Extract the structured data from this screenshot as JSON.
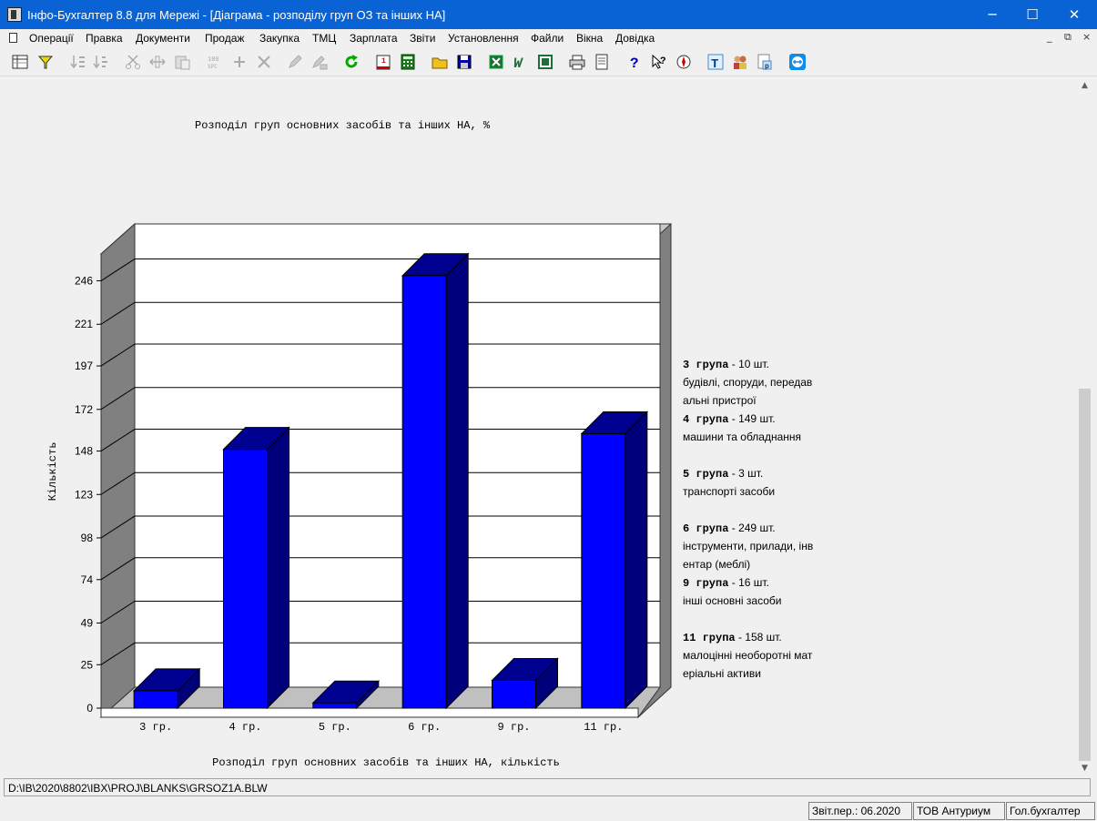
{
  "window": {
    "title": "Інфо-Бухгалтер 8.8 для Мережі - [Діаграма - розподілу груп ОЗ та інших НА]",
    "minimize": "─",
    "maximize": "☐",
    "close": "✕"
  },
  "menu": {
    "items": [
      "Операції",
      "Правка",
      "Документи",
      "Продаж",
      "Закупка",
      "ТМЦ",
      "Зарплата",
      "Звіти",
      "Установлення",
      "Файли",
      "Вікна",
      "Довідка"
    ],
    "mdi_minimize": "_",
    "mdi_restore": "⧉",
    "mdi_close": "×"
  },
  "toolbar": {
    "icons": [
      "grid-icon",
      "filter-icon",
      "sort-asc-icon",
      "sort-desc-icon",
      "cut-icon",
      "move-icon",
      "paste-icon",
      "rotate-icon",
      "add-icon",
      "delete-icon",
      "edit-icon",
      "spray-icon",
      "refresh-icon",
      "calendar-icon",
      "calculator-icon",
      "open-folder-icon",
      "save-icon",
      "excel-icon",
      "word-icon",
      "export-icon",
      "print-icon",
      "preview-icon",
      "help-icon",
      "context-help-icon",
      "compass-icon",
      "text-tool-icon",
      "users-icon",
      "report-icon",
      "teamviewer-icon"
    ]
  },
  "chart": {
    "title": "Розподіл груп основних засобів та інших НА, %",
    "ylabel": "Кількість",
    "xlabel": "Розподіл груп основних засобів та інших НА, кількість",
    "bar_color": "#0000ff",
    "bar_top_color": "#000090",
    "bar_side_color": "#00007a"
  },
  "chart_data": {
    "type": "bar",
    "categories": [
      "3  гр.",
      "4  гр.",
      "5  гр.",
      "6  гр.",
      "9  гр.",
      "11 гр."
    ],
    "values": [
      10,
      149,
      3,
      249,
      16,
      158
    ],
    "yticks": [
      0,
      25,
      49,
      74,
      98,
      123,
      148,
      172,
      197,
      221,
      246
    ],
    "ylim": [
      0,
      262
    ],
    "grid": true,
    "ylabel": "Кількість",
    "xlabel": "Розподіл груп основних засобів та інших НА, кількість",
    "title": "Розподіл груп основних засобів та інших НА, %"
  },
  "legend": [
    {
      "group": "3   група",
      "count": " - 10 шт.",
      "lines": [
        "будівлі, споруди, передав",
        "альні пристрої"
      ]
    },
    {
      "group": "4   група",
      "count": " - 149 шт.",
      "lines": [
        "машини та обладнання",
        ""
      ]
    },
    {
      "group": "5   група",
      "count": " - 3 шт.",
      "lines": [
        "транспорті засоби",
        ""
      ]
    },
    {
      "group": "6   група",
      "count": " - 249 шт.",
      "lines": [
        "інструменти, прилади, інв",
        "ентар (меблі)"
      ]
    },
    {
      "group": "9   група",
      "count": " - 16 шт.",
      "lines": [
        "інші основні засоби",
        ""
      ]
    },
    {
      "group": "11  група",
      "count": " - 158 шт.",
      "lines": [
        "малоцінні необоротні мат",
        "еріальні активи"
      ]
    }
  ],
  "pathbar": {
    "path": "D:\\IB\\2020\\8802\\IBX\\PROJ\\BLANKS\\GRSOZ1A.BLW"
  },
  "status": {
    "period": "Звіт.пер.: 06.2020",
    "company": "ТОВ Антуриум",
    "role": "Гол.бухгалтер"
  }
}
